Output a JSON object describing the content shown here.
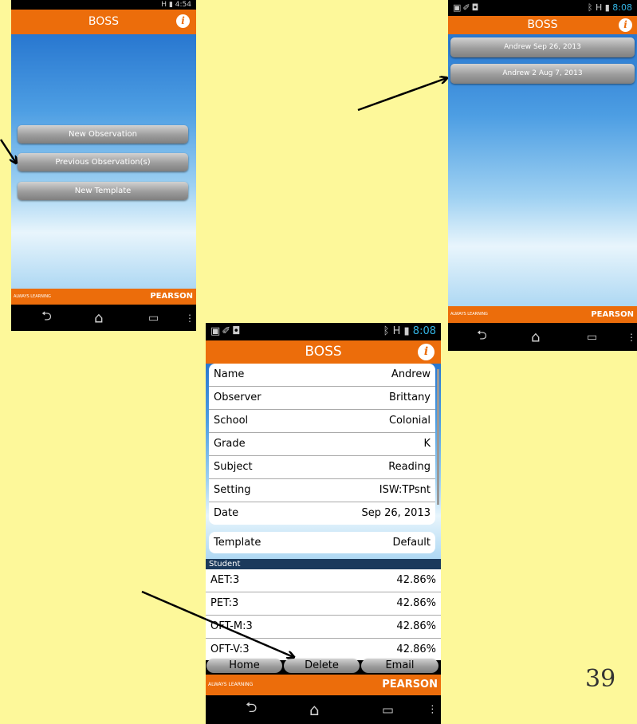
{
  "phone1": {
    "status": {
      "signal": "H",
      "time": "4:54"
    },
    "app_title": "BOSS",
    "info_glyph": "i",
    "buttons": [
      "New Observation",
      "Previous Observation(s)",
      "New Template"
    ],
    "footer": {
      "left": "ALWAYS LEARNING",
      "right": "PEARSON"
    }
  },
  "phone2": {
    "status": {
      "signal": "H",
      "time": "8:08"
    },
    "app_title": "BOSS",
    "info_glyph": "i",
    "observations": [
      "Andrew  Sep 26, 2013",
      "Andrew 2  Aug 7, 2013"
    ],
    "footer": {
      "left": "ALWAYS LEARNING",
      "right": "PEARSON"
    }
  },
  "phone3": {
    "status": {
      "signal": "H",
      "time": "8:08"
    },
    "app_title": "BOSS",
    "info_glyph": "i",
    "details": [
      {
        "k": "Name",
        "v": "Andrew"
      },
      {
        "k": "Observer",
        "v": "Brittany"
      },
      {
        "k": "School",
        "v": "Colonial"
      },
      {
        "k": "Grade",
        "v": "K"
      },
      {
        "k": "Subject",
        "v": "Reading"
      },
      {
        "k": "Setting",
        "v": "ISW:TPsnt"
      },
      {
        "k": "Date",
        "v": "Sep 26, 2013"
      }
    ],
    "template": {
      "k": "Template",
      "v": "Default"
    },
    "student_header": "Student",
    "students": [
      {
        "k": "AET:3",
        "v": "42.86%"
      },
      {
        "k": "PET:3",
        "v": "42.86%"
      },
      {
        "k": "OFT-M:3",
        "v": "42.86%"
      },
      {
        "k": "OFT-V:3",
        "v": "42.86%"
      }
    ],
    "buttons": {
      "home": "Home",
      "delete": "Delete",
      "email": "Email"
    },
    "footer": {
      "left": "ALWAYS LEARNING",
      "right": "PEARSON"
    }
  },
  "slide_number": "39",
  "icons": [
    "back-icon",
    "home-icon",
    "recents-icon",
    "menu-dots-icon",
    "info-icon",
    "gallery-icon",
    "bluetooth-icon",
    "battery-icon",
    "arrow-icon"
  ]
}
